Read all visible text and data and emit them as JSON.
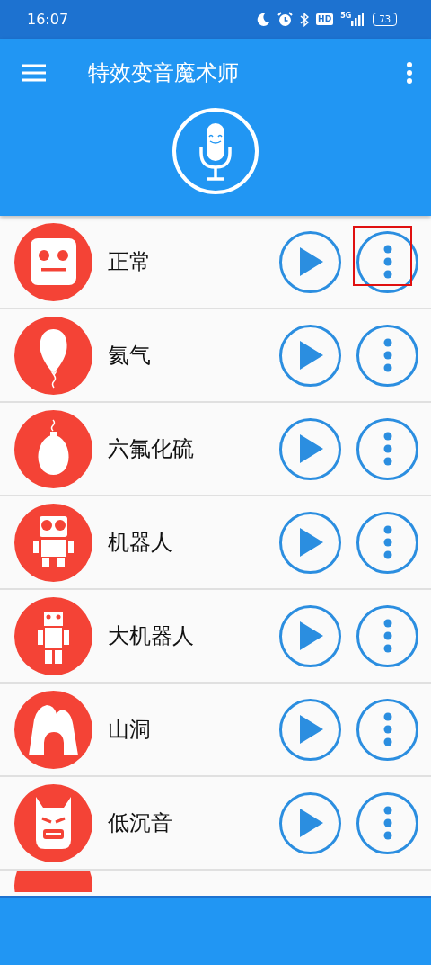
{
  "status_bar": {
    "time": "16:07",
    "hd_label": "HD",
    "network": "5G",
    "battery": "73"
  },
  "app_bar": {
    "title": "特效变音魔术师"
  },
  "effects": [
    {
      "name": "正常",
      "kind": "face",
      "highlighted": true
    },
    {
      "name": "氦气",
      "kind": "balloon",
      "highlighted": false
    },
    {
      "name": "六氟化硫",
      "kind": "weight",
      "highlighted": false
    },
    {
      "name": "机器人",
      "kind": "robot",
      "highlighted": false
    },
    {
      "name": "大机器人",
      "kind": "giant",
      "highlighted": false
    },
    {
      "name": "山洞",
      "kind": "cave",
      "highlighted": false
    },
    {
      "name": "低沉音",
      "kind": "mask",
      "highlighted": false
    },
    {
      "kind": "partial"
    }
  ]
}
